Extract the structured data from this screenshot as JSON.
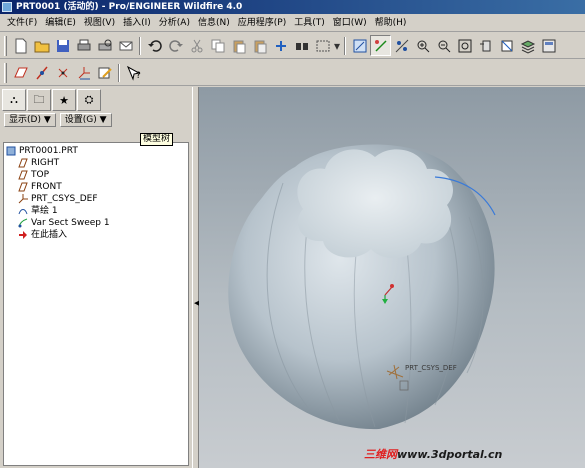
{
  "window": {
    "title": "PRT0001 (活动的) - Pro/ENGINEER Wildfire 4.0"
  },
  "menu": [
    "文件(F)",
    "编辑(E)",
    "视图(V)",
    "插入(I)",
    "分析(A)",
    "信息(N)",
    "应用程序(P)",
    "工具(T)",
    "窗口(W)",
    "帮助(H)"
  ],
  "panel": {
    "show_label": "显示(D) ▼",
    "settings_label": "设置(G) ▼",
    "tooltip": "模型树"
  },
  "tree": [
    {
      "label": "PRT0001.PRT",
      "icon": "part-icon"
    },
    {
      "label": "RIGHT",
      "icon": "datum-plane-icon"
    },
    {
      "label": "TOP",
      "icon": "datum-plane-icon"
    },
    {
      "label": "FRONT",
      "icon": "datum-plane-icon"
    },
    {
      "label": "PRT_CSYS_DEF",
      "icon": "csys-icon"
    },
    {
      "label": "草绘 1",
      "icon": "sketch-icon"
    },
    {
      "label": "Var Sect Sweep 1",
      "icon": "sweep-icon"
    },
    {
      "label": "在此插入",
      "icon": "insert-arrow-icon"
    }
  ],
  "viewport": {
    "csys_label": "PRT_CSYS_DEF",
    "watermark_brand": "三维网",
    "watermark_url": "www.3dportal.cn"
  },
  "colors": {
    "accent": "#0a246a",
    "model": "#b7c3cc"
  }
}
